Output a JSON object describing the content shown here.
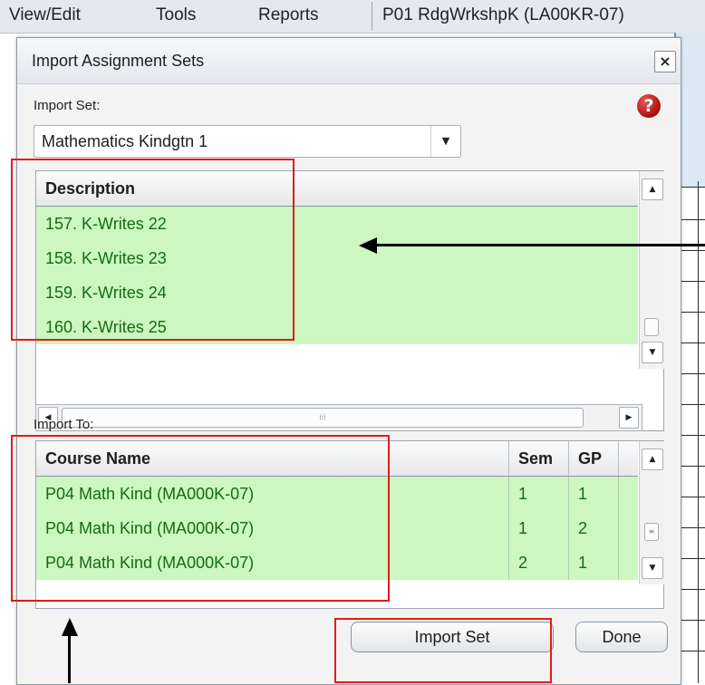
{
  "menubar": {
    "items": [
      "View/Edit",
      "Tools",
      "Reports"
    ],
    "course": "P01  RdgWrkshpK (LA00KR-07)"
  },
  "dialog": {
    "title": "Import Assignment Sets",
    "close_icon": "close-icon",
    "help_icon": "question-mark-help-icon",
    "import_set_label": "Import Set:",
    "import_set_value": "Mathematics Kindgtn 1",
    "description_header": "Description",
    "descriptions": [
      "157. K-Writes 22",
      "158. K-Writes 23",
      "159. K-Writes 24",
      "160. K-Writes 25"
    ],
    "import_to_label": "Import To:",
    "course_columns": [
      "Course Name",
      "Sem",
      "GP"
    ],
    "courses": [
      {
        "name": "P04   Math Kind (MA000K-07)",
        "sem": "1",
        "gp": "1"
      },
      {
        "name": "P04   Math Kind (MA000K-07)",
        "sem": "1",
        "gp": "2"
      },
      {
        "name": "P04   Math Kind (MA000K-07)",
        "sem": "2",
        "gp": "1"
      }
    ],
    "import_button": "Import Set",
    "done_button": "Done"
  },
  "colors": {
    "row_highlight": "#ccf7c0",
    "row_text": "#156b15",
    "annotation": "#e11b1b"
  }
}
